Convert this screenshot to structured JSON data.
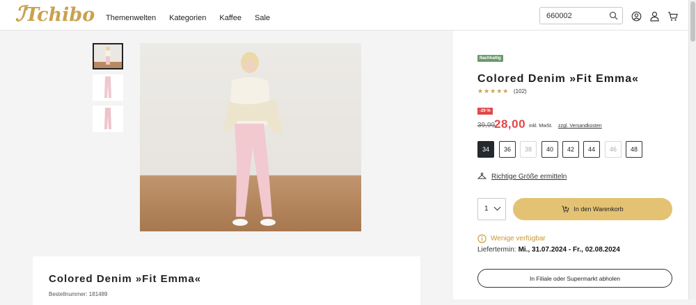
{
  "header": {
    "logo_text": "Tchibo",
    "nav": [
      "Themenwelten",
      "Kategorien",
      "Kaffee",
      "Sale"
    ],
    "search_value": "660002",
    "icons": [
      "search-icon",
      "account-circle-icon",
      "user-icon",
      "cart-icon"
    ]
  },
  "product": {
    "badge": "Nachhaltig",
    "title": "Colored Denim »Fit Emma«",
    "stars": "★★★★★",
    "rating": 4.5,
    "reviews": "(102)",
    "discount": "-29 %",
    "old_price": "39,99",
    "price": "28,00",
    "vat": "inkl. MwSt.",
    "shipping": "zzgl. Versandkosten",
    "sizes": [
      {
        "label": "34",
        "state": "selected"
      },
      {
        "label": "36",
        "state": "available"
      },
      {
        "label": "38",
        "state": "unavailable"
      },
      {
        "label": "40",
        "state": "available"
      },
      {
        "label": "42",
        "state": "available"
      },
      {
        "label": "44",
        "state": "available"
      },
      {
        "label": "46",
        "state": "unavailable"
      },
      {
        "label": "48",
        "state": "available"
      }
    ],
    "size_guide": "Richtige Größe ermitteln",
    "quantity": "1",
    "add_to_cart": "In den Warenkorb",
    "availability": "Wenige verfügbar",
    "delivery_label": "Liefertermin:",
    "delivery_dates": "Mi., 31.07.2024 - Fr., 02.08.2024",
    "store_pickup": "In Filiale oder Supermarkt abholen"
  },
  "details": {
    "title": "Colored Denim »Fit Emma«",
    "order_number": "Bestellnummer: 181489"
  },
  "colors": {
    "brand_gold": "#c9a24e",
    "cart_button": "#e4c273",
    "sale_red": "#e04848",
    "badge_green": "#6b9a6b",
    "selected_size": "#23292d"
  }
}
